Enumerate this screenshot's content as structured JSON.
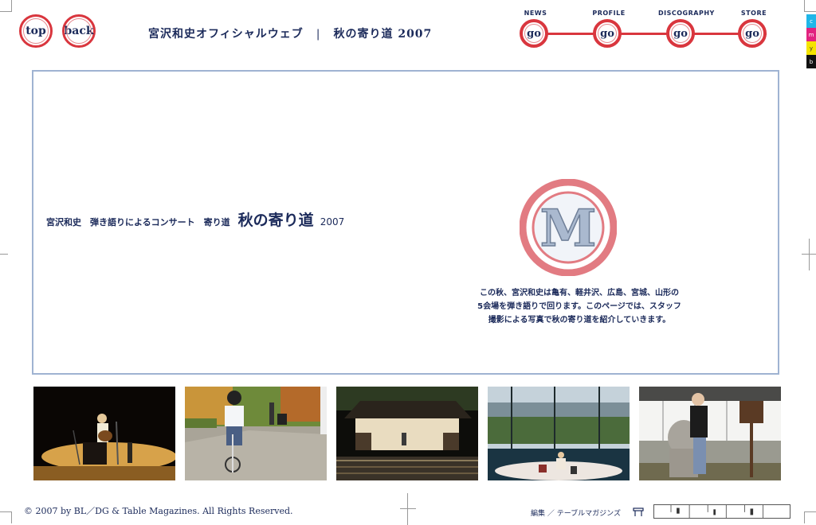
{
  "header": {
    "top_button": "top",
    "back_button": "back",
    "site_title": "宮沢和史オフィシャルウェブ",
    "separator": "|",
    "page_title": "秋の寄り道 2007"
  },
  "nav": [
    {
      "label": "NEWS",
      "button": "go"
    },
    {
      "label": "PROFILE",
      "button": "go"
    },
    {
      "label": "DISCOGRAPHY",
      "button": "go"
    },
    {
      "label": "STORE",
      "button": "go"
    }
  ],
  "swatches": [
    {
      "letter": "c",
      "color": "#1fb6e8"
    },
    {
      "letter": "m",
      "color": "#e2227f"
    },
    {
      "letter": "y",
      "color": "#f5e400"
    },
    {
      "letter": "b",
      "color": "#111111"
    }
  ],
  "main": {
    "intro_small": "宮沢和史　弾き語りによるコンサート　寄り道",
    "intro_big": "秋の寄り道",
    "intro_year": "2007",
    "logo_letter": "M",
    "description_lines": [
      "この秋、宮沢和史は亀有、軽井沢、広島、宮城、山形の",
      "5会場を弾き語りで回ります。このページでは、スタッフ",
      "撮影による写真で秋の寄り道を紹介していきます。"
    ]
  },
  "photos": [
    {
      "name": "concert-stage-guitar"
    },
    {
      "name": "bicycle-ride"
    },
    {
      "name": "outdoor-stage-crowd"
    },
    {
      "name": "lakeside-stage"
    },
    {
      "name": "stone-statue"
    }
  ],
  "footer": {
    "copyright": "© 2007 by BL／DG & Table Magazines. All Rights Reserved.",
    "credit": "編集 ／ テーブルマガジンズ"
  },
  "colors": {
    "accent_red": "#d9363e",
    "navy_text": "#1b2a5a",
    "panel_border": "#9fb3d2"
  }
}
